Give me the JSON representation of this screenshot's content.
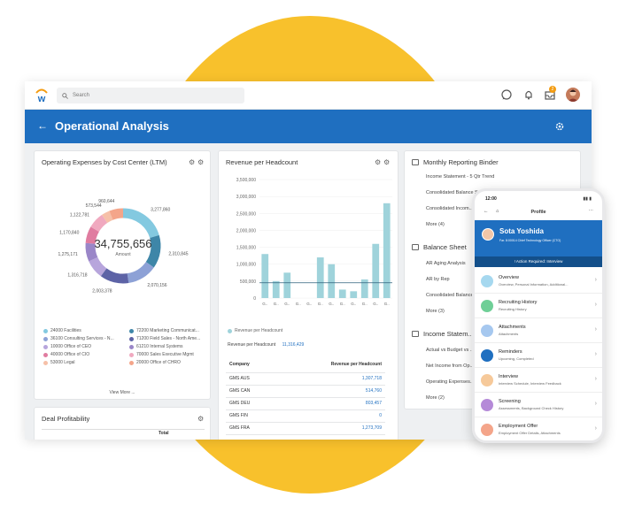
{
  "search": {
    "placeholder": "Search"
  },
  "topbar": {
    "notification_count": "2"
  },
  "header": {
    "title": "Operational Analysis"
  },
  "expenses_card": {
    "title": "Operating Expenses by Cost Center (LTM)",
    "total": "34,755,656",
    "total_label": "Amount",
    "view_more": "View More ..."
  },
  "chart_data": [
    {
      "type": "pie",
      "title": "Operating Expenses by Cost Center (LTM)",
      "center_label": "Amount",
      "center_value": "34,755,656",
      "slice_labels": [
        "3,277,860",
        "2,310,845",
        "2,070,156",
        "2,003,378",
        "1,316,718",
        "1,275,171",
        "1,170,840",
        "1,122,781",
        "573,544",
        "960,644"
      ],
      "values": [
        3277860,
        2310845,
        2070156,
        2003378,
        1316718,
        1275171,
        1170840,
        1122781,
        573544,
        960644
      ],
      "colors": [
        "#83c9e0",
        "#3e86a8",
        "#8da1d6",
        "#5d63a6",
        "#b7a5dc",
        "#9a86c8",
        "#e07ca0",
        "#f0a9bf",
        "#f6c0a8",
        "#f4a58a"
      ],
      "legend": [
        {
          "label": "24000 Facilities",
          "color": "#83c9e0"
        },
        {
          "label": "72200 Marketing Communicat...",
          "color": "#3e86a8"
        },
        {
          "label": "36100 Consulting Services - N...",
          "color": "#8da1d6"
        },
        {
          "label": "71200 Field Sales - North Ame...",
          "color": "#5d63a6"
        },
        {
          "label": "10000 Office of CEO",
          "color": "#b7a5dc"
        },
        {
          "label": "61210 Internal Systems",
          "color": "#9a86c8"
        },
        {
          "label": "40000 Office of CIO",
          "color": "#e07ca0"
        },
        {
          "label": "70000 Sales Executive Mgmt",
          "color": "#f0a9bf"
        },
        {
          "label": "53000 Legal",
          "color": "#f6c0a8"
        },
        {
          "label": "20000 Office of CHRO",
          "color": "#f4a58a"
        }
      ]
    },
    {
      "type": "bar",
      "title": "Revenue per Headcount",
      "ylim": [
        0,
        3500000
      ],
      "yticks": [
        "3,500,000",
        "3,000,000",
        "2,500,000",
        "2,000,000",
        "1,500,000",
        "1,000,000",
        "500,000",
        "0"
      ],
      "categories": [
        "G..",
        "G..",
        "G..",
        "G..",
        "G..",
        "G..",
        "G..",
        "G..",
        "G..",
        "G..",
        "G..",
        "G.."
      ],
      "values": [
        1300000,
        500000,
        750000,
        0,
        0,
        1200000,
        1000000,
        250000,
        200000,
        550000,
        1600000,
        2800000
      ],
      "reference_value": 450000,
      "legend": "Revenue per Headcount",
      "color": "#9fd3db"
    }
  ],
  "revenue_card": {
    "title": "Revenue per Headcount",
    "summary_label": "Revenue per Headcount",
    "summary_value": "11,316,429",
    "table": {
      "headers": [
        "Company",
        "Revenue per Headcount"
      ],
      "rows": [
        [
          "GMS AUS",
          "1,307,718"
        ],
        [
          "GMS CAN",
          "514,760"
        ],
        [
          "GMS DEU",
          "803,457"
        ],
        [
          "GMS FIN",
          "0"
        ],
        [
          "GMS FRA",
          "1,273,709"
        ]
      ]
    }
  },
  "binder_card": {
    "title": "Monthly Reporting Binder",
    "sections": [
      {
        "title": "",
        "items": [
          "Income Statement - 5 Qtr Trend",
          "Consolidated Balance S...",
          "Consolidated Incom...",
          "More (4)"
        ]
      },
      {
        "title": "Balance Sheet",
        "items": [
          "AR Aging Analysis",
          "AR by Rep",
          "Consolidated Balance S...",
          "More (3)"
        ]
      },
      {
        "title": "Income Statem...",
        "items": [
          "Actual vs Budget vs ...",
          "Net Income from Op...",
          "Operating Expenses...",
          "More (2)"
        ]
      }
    ]
  },
  "deal_card": {
    "title": "Deal Profitability",
    "column": "Total"
  },
  "phone": {
    "time": "12:00",
    "title": "Profile",
    "name": "Sota Yoshida",
    "role": "Far. 8:00014 Chief Technology Officer (CTO)",
    "action": "Action Required: Interview",
    "items": [
      {
        "title": "Overview",
        "sub": "Overview, Personal Information, Additional...",
        "color": "#a6d8ef"
      },
      {
        "title": "Recruiting History",
        "sub": "Recruiting History",
        "color": "#6fcf97"
      },
      {
        "title": "Attachments",
        "sub": "Attachments",
        "color": "#a6c8ef"
      },
      {
        "title": "Reminders",
        "sub": "Upcoming, Completed",
        "color": "#1f6fc0"
      },
      {
        "title": "Interview",
        "sub": "Interview Schedule, Interview Feedback",
        "color": "#f6c99a"
      },
      {
        "title": "Screening",
        "sub": "Assessments, Background Check History",
        "color": "#b58ad8"
      },
      {
        "title": "Employment Offer",
        "sub": "Employment Offer Details, Attachments",
        "color": "#f4a58a"
      }
    ]
  }
}
